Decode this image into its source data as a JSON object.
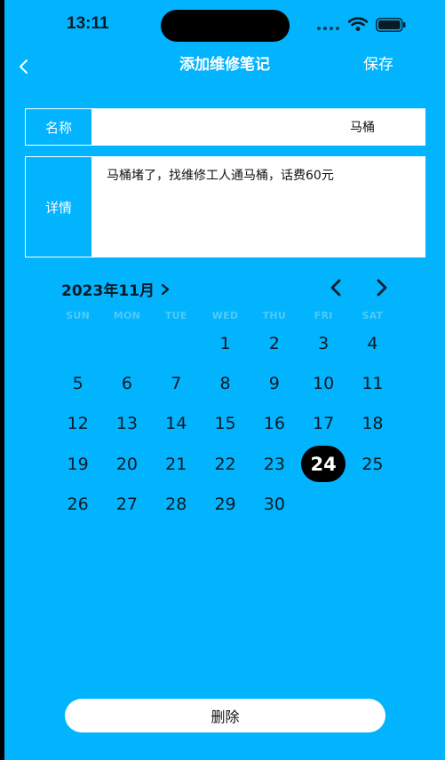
{
  "status_bar": {
    "time": "13:11"
  },
  "nav": {
    "back_icon": "chevron-left-icon",
    "title": "添加维修笔记",
    "save_label": "保存"
  },
  "form": {
    "name_label": "名称",
    "name_value": "马桶",
    "detail_label": "详情",
    "detail_value": "马桶堵了，找维修工人通马桶，话费60元"
  },
  "calendar": {
    "month_label": "2023年11月",
    "weekdays": [
      "SUN",
      "MON",
      "TUE",
      "WED",
      "THU",
      "FRI",
      "SAT"
    ],
    "first_weekday_index": 3,
    "days": [
      "1",
      "2",
      "3",
      "4",
      "5",
      "6",
      "7",
      "8",
      "9",
      "10",
      "11",
      "12",
      "13",
      "14",
      "15",
      "16",
      "17",
      "18",
      "19",
      "20",
      "21",
      "22",
      "23",
      "24",
      "25",
      "26",
      "27",
      "28",
      "29",
      "30"
    ],
    "selected_day": "24",
    "colors": {
      "weekday_header": "#4fcbf9",
      "selected_bg": "#000000"
    }
  },
  "footer": {
    "delete_label": "删除"
  },
  "theme": {
    "background": "#02b3fd"
  }
}
